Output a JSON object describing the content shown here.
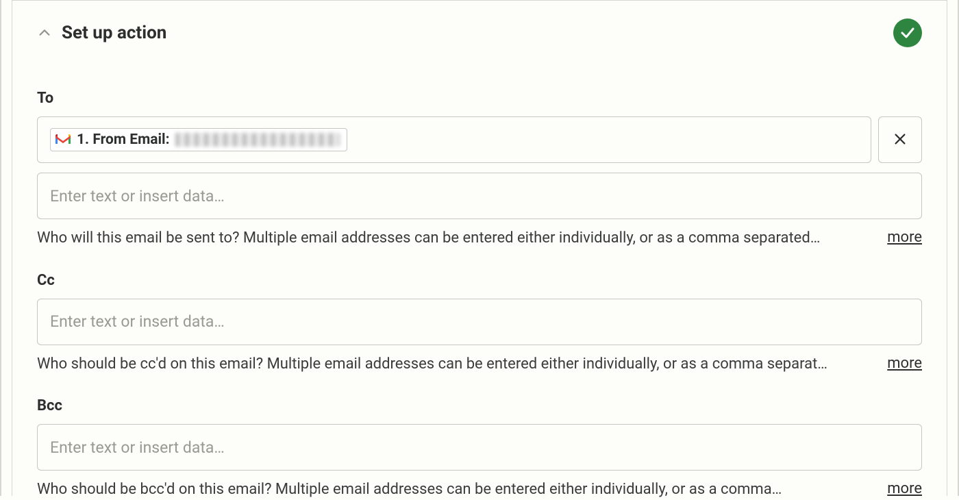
{
  "section": {
    "title": "Set up action",
    "status": "complete"
  },
  "fields": {
    "to": {
      "label": "To",
      "pill": {
        "source_label": "1. From Email:",
        "source_value_redacted": true
      },
      "placeholder": "Enter text or insert data…",
      "help": "Who will this email be sent to? Multiple email addresses can be entered either individually, or as a comma separated…",
      "more": "more"
    },
    "cc": {
      "label": "Cc",
      "placeholder": "Enter text or insert data…",
      "help": "Who should be cc'd on this email? Multiple email addresses can be entered either individually, or as a comma separat…",
      "more": "more"
    },
    "bcc": {
      "label": "Bcc",
      "placeholder": "Enter text or insert data…",
      "help": "Who should be bcc'd on this email? Multiple email addresses can be entered either individually, or as a comma…",
      "more": "more"
    }
  }
}
